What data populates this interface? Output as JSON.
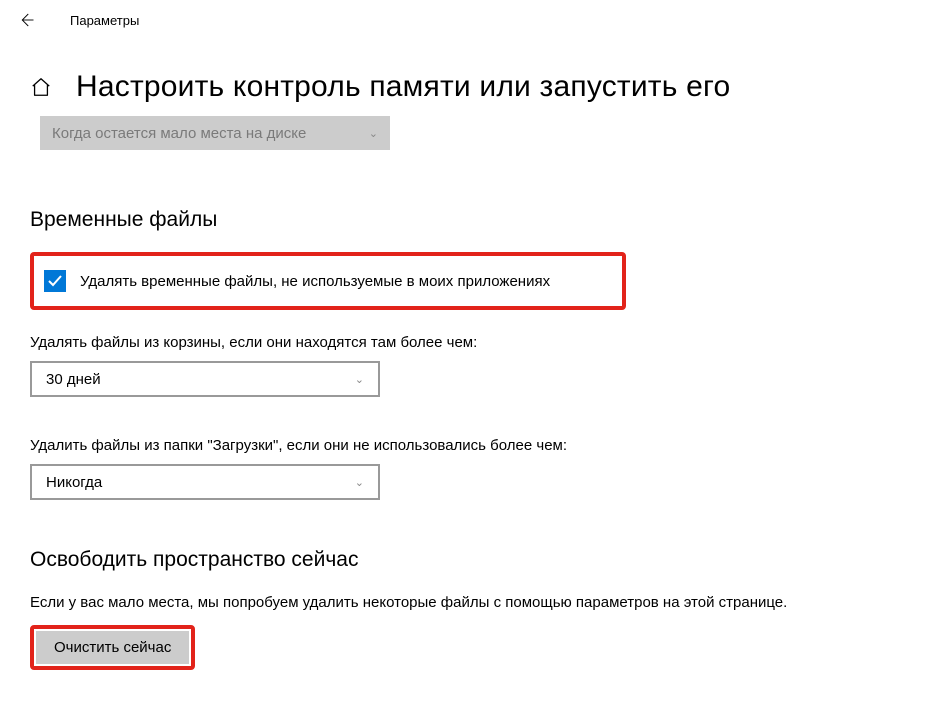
{
  "titlebar": {
    "app_name": "Параметры"
  },
  "header": {
    "title": "Настроить контроль памяти или запустить его"
  },
  "run_dropdown": {
    "value": "Когда остается мало места на диске"
  },
  "temp_files": {
    "heading": "Временные файлы",
    "checkbox_label": "Удалять временные файлы, не используемые в моих приложениях",
    "recycle_label": "Удалять файлы из корзины, если они находятся там более чем:",
    "recycle_value": "30 дней",
    "downloads_label": "Удалить файлы из папки \"Загрузки\", если они не использовались более чем:",
    "downloads_value": "Никогда"
  },
  "freeup": {
    "heading": "Освободить пространство сейчас",
    "description": "Если у вас мало места, мы попробуем удалить некоторые файлы с помощью параметров на этой странице.",
    "button_label": "Очистить сейчас"
  }
}
